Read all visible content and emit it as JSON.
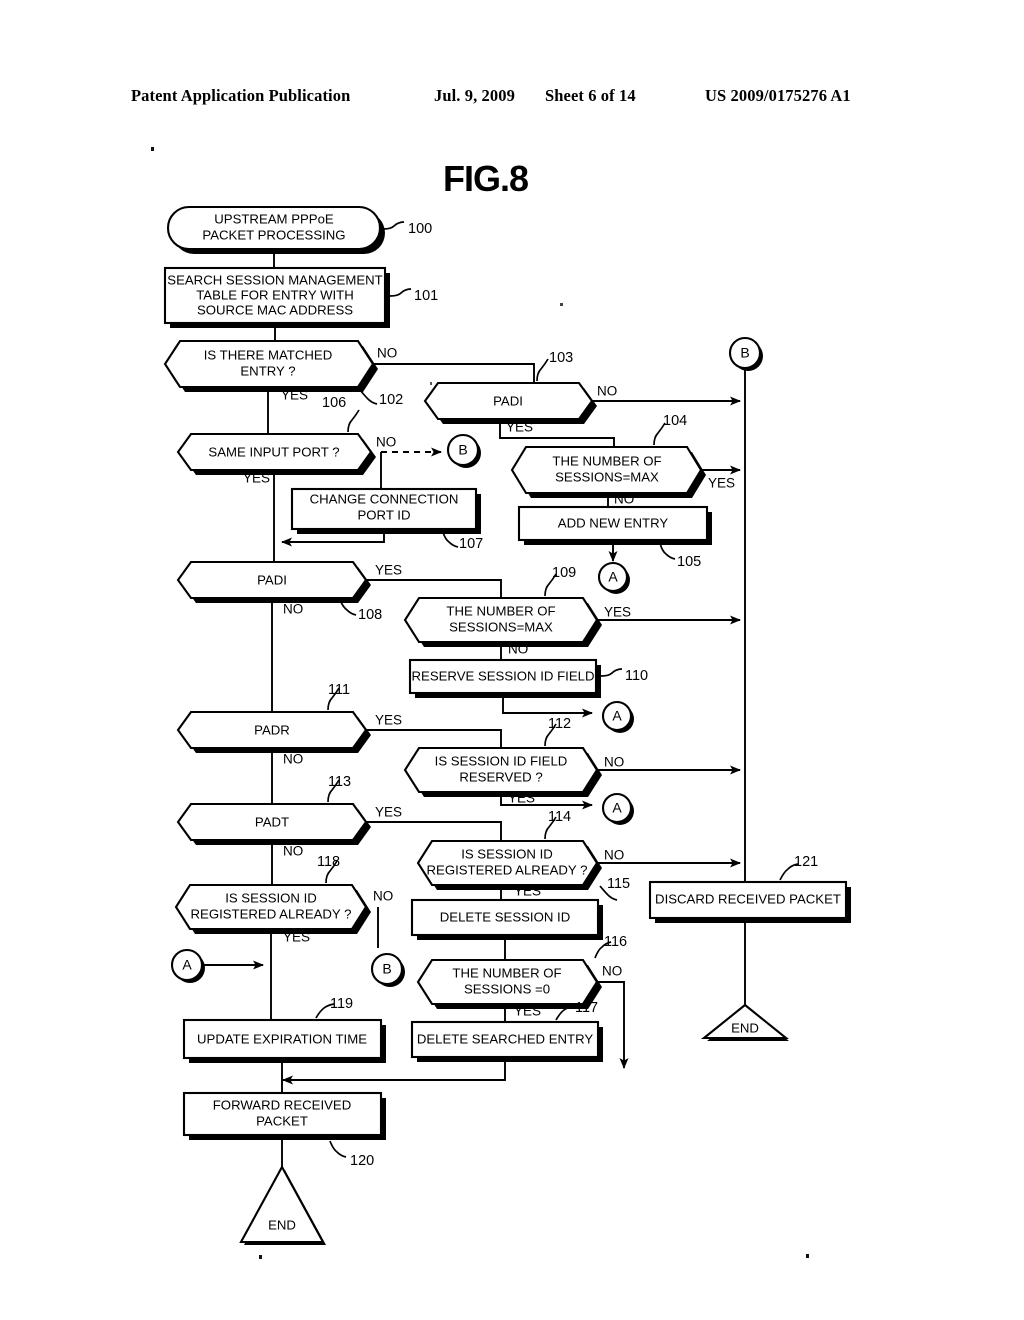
{
  "header": {
    "publication": "Patent Application Publication",
    "date": "Jul. 9, 2009",
    "sheet": "Sheet 6 of 14",
    "patent_number": "US 2009/0175276 A1"
  },
  "figure": {
    "title": "FIG.8"
  },
  "nodes": {
    "n100": {
      "ref": "100",
      "text1": "UPSTREAM PPPoE",
      "text2": "PACKET PROCESSING",
      "type": "terminal"
    },
    "n101": {
      "ref": "101",
      "text1": "SEARCH SESSION MANAGEMENT",
      "text2": "TABLE FOR ENTRY WITH",
      "text3": "SOURCE MAC ADDRESS",
      "type": "process"
    },
    "n102": {
      "ref": "102",
      "text1": "IS THERE MATCHED",
      "text2": "ENTRY ?",
      "type": "decision"
    },
    "n103": {
      "ref": "103",
      "text1": "PADI",
      "type": "decision"
    },
    "n104": {
      "ref": "104",
      "text1": "THE NUMBER OF",
      "text2": "SESSIONS=MAX",
      "type": "decision"
    },
    "n105": {
      "ref": "105",
      "text1": "ADD NEW ENTRY",
      "type": "process"
    },
    "n106": {
      "ref": "106",
      "text1": "SAME INPUT PORT ?",
      "type": "decision"
    },
    "n107": {
      "ref": "107",
      "text1": "CHANGE CONNECTION",
      "text2": "PORT ID",
      "type": "process"
    },
    "n108": {
      "ref": "108",
      "text1": "PADI",
      "type": "decision"
    },
    "n109": {
      "ref": "109",
      "text1": "THE NUMBER OF",
      "text2": "SESSIONS=MAX",
      "type": "decision"
    },
    "n110": {
      "ref": "110",
      "text1": "RESERVE SESSION ID FIELD",
      "type": "process"
    },
    "n111": {
      "ref": "111",
      "text1": "PADR",
      "type": "decision"
    },
    "n112": {
      "ref": "112",
      "text1": "IS SESSION ID FIELD",
      "text2": "RESERVED ?",
      "type": "decision"
    },
    "n113": {
      "ref": "113",
      "text1": "PADT",
      "type": "decision"
    },
    "n114": {
      "ref": "114",
      "text1": "IS SESSION ID",
      "text2": "REGISTERED ALREADY ?",
      "type": "decision"
    },
    "n115": {
      "ref": "115",
      "text1": "DELETE SESSION ID",
      "type": "process"
    },
    "n116": {
      "ref": "116",
      "text1": "THE NUMBER OF",
      "text2": "SESSIONS =0",
      "type": "decision"
    },
    "n117": {
      "ref": "117",
      "text1": "DELETE SEARCHED ENTRY",
      "type": "process"
    },
    "n118": {
      "ref": "118",
      "text1": "IS SESSION ID",
      "text2": "REGISTERED ALREADY ?",
      "type": "decision"
    },
    "n119": {
      "ref": "119",
      "text1": "UPDATE EXPIRATION TIME",
      "type": "process"
    },
    "n120": {
      "ref": "120",
      "text1": "FORWARD RECEIVED",
      "text2": "PACKET",
      "type": "process"
    },
    "n121": {
      "ref": "121",
      "text1": "DISCARD RECEIVED PACKET",
      "type": "process"
    },
    "end_left": {
      "text1": "END",
      "type": "terminal-triangle"
    },
    "end_right": {
      "text1": "END",
      "type": "terminal-triangle"
    }
  },
  "connectors": {
    "b_top": "B",
    "b_same_input_port": "B",
    "a_add_new_entry": "A",
    "a_reserve": "A",
    "a_session_reserved": "A",
    "a_left_join": "A",
    "b_padt_no": "B"
  },
  "edge_labels": {
    "n102_no": "NO",
    "n102_yes": "YES",
    "n103_no": "NO",
    "n103_yes": "YES",
    "n104_yes": "YES",
    "n104_no": "NO",
    "n106_no": "NO",
    "n106_yes": "YES",
    "n108_yes": "YES",
    "n108_no": "NO",
    "n109_yes": "YES",
    "n109_no": "NO",
    "n111_yes": "YES",
    "n111_no": "NO",
    "n112_no": "NO",
    "n112_yes": "YES",
    "n113_yes": "YES",
    "n113_no": "NO",
    "n114_no": "NO",
    "n114_yes": "YES",
    "n116_no": "NO",
    "n116_yes": "YES",
    "n118_no": "NO",
    "n118_yes": "YES"
  }
}
